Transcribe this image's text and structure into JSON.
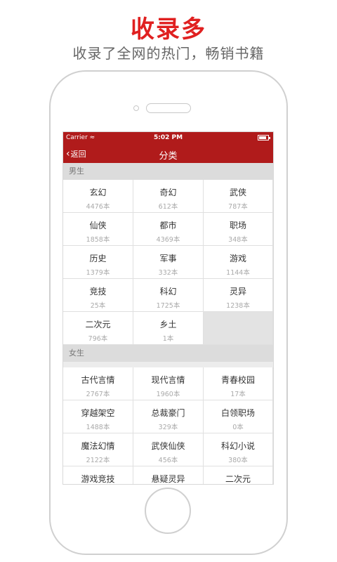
{
  "promo": {
    "headline": "收录多",
    "subline": "收录了全网的热门，畅销书籍"
  },
  "status_bar": {
    "carrier": "Carrier",
    "time": "5:02 PM",
    "battery_level": 0.85
  },
  "nav": {
    "back_label": "返回",
    "title": "分类"
  },
  "sections": [
    {
      "title": "男生",
      "items": [
        {
          "name": "玄幻",
          "count": "4476本"
        },
        {
          "name": "奇幻",
          "count": "612本"
        },
        {
          "name": "武侠",
          "count": "787本"
        },
        {
          "name": "仙侠",
          "count": "1858本"
        },
        {
          "name": "都市",
          "count": "4369本"
        },
        {
          "name": "职场",
          "count": "348本"
        },
        {
          "name": "历史",
          "count": "1379本"
        },
        {
          "name": "军事",
          "count": "332本"
        },
        {
          "name": "游戏",
          "count": "1144本"
        },
        {
          "name": "竞技",
          "count": "25本"
        },
        {
          "name": "科幻",
          "count": "1725本"
        },
        {
          "name": "灵异",
          "count": "1238本"
        },
        {
          "name": "二次元",
          "count": "796本"
        },
        {
          "name": "乡土",
          "count": "1本"
        }
      ]
    },
    {
      "title": "女生",
      "items": [
        {
          "name": "古代言情",
          "count": "2767本"
        },
        {
          "name": "现代言情",
          "count": "1960本"
        },
        {
          "name": "青春校园",
          "count": "17本"
        },
        {
          "name": "穿越架空",
          "count": "1488本"
        },
        {
          "name": "总裁豪门",
          "count": "329本"
        },
        {
          "name": "白领职场",
          "count": "0本"
        },
        {
          "name": "魔法幻情",
          "count": "2122本"
        },
        {
          "name": "武侠仙侠",
          "count": "456本"
        },
        {
          "name": "科幻小说",
          "count": "380本"
        },
        {
          "name": "游戏竞技",
          "count": ""
        },
        {
          "name": "悬疑灵异",
          "count": ""
        },
        {
          "name": "二次元",
          "count": ""
        }
      ]
    }
  ]
}
